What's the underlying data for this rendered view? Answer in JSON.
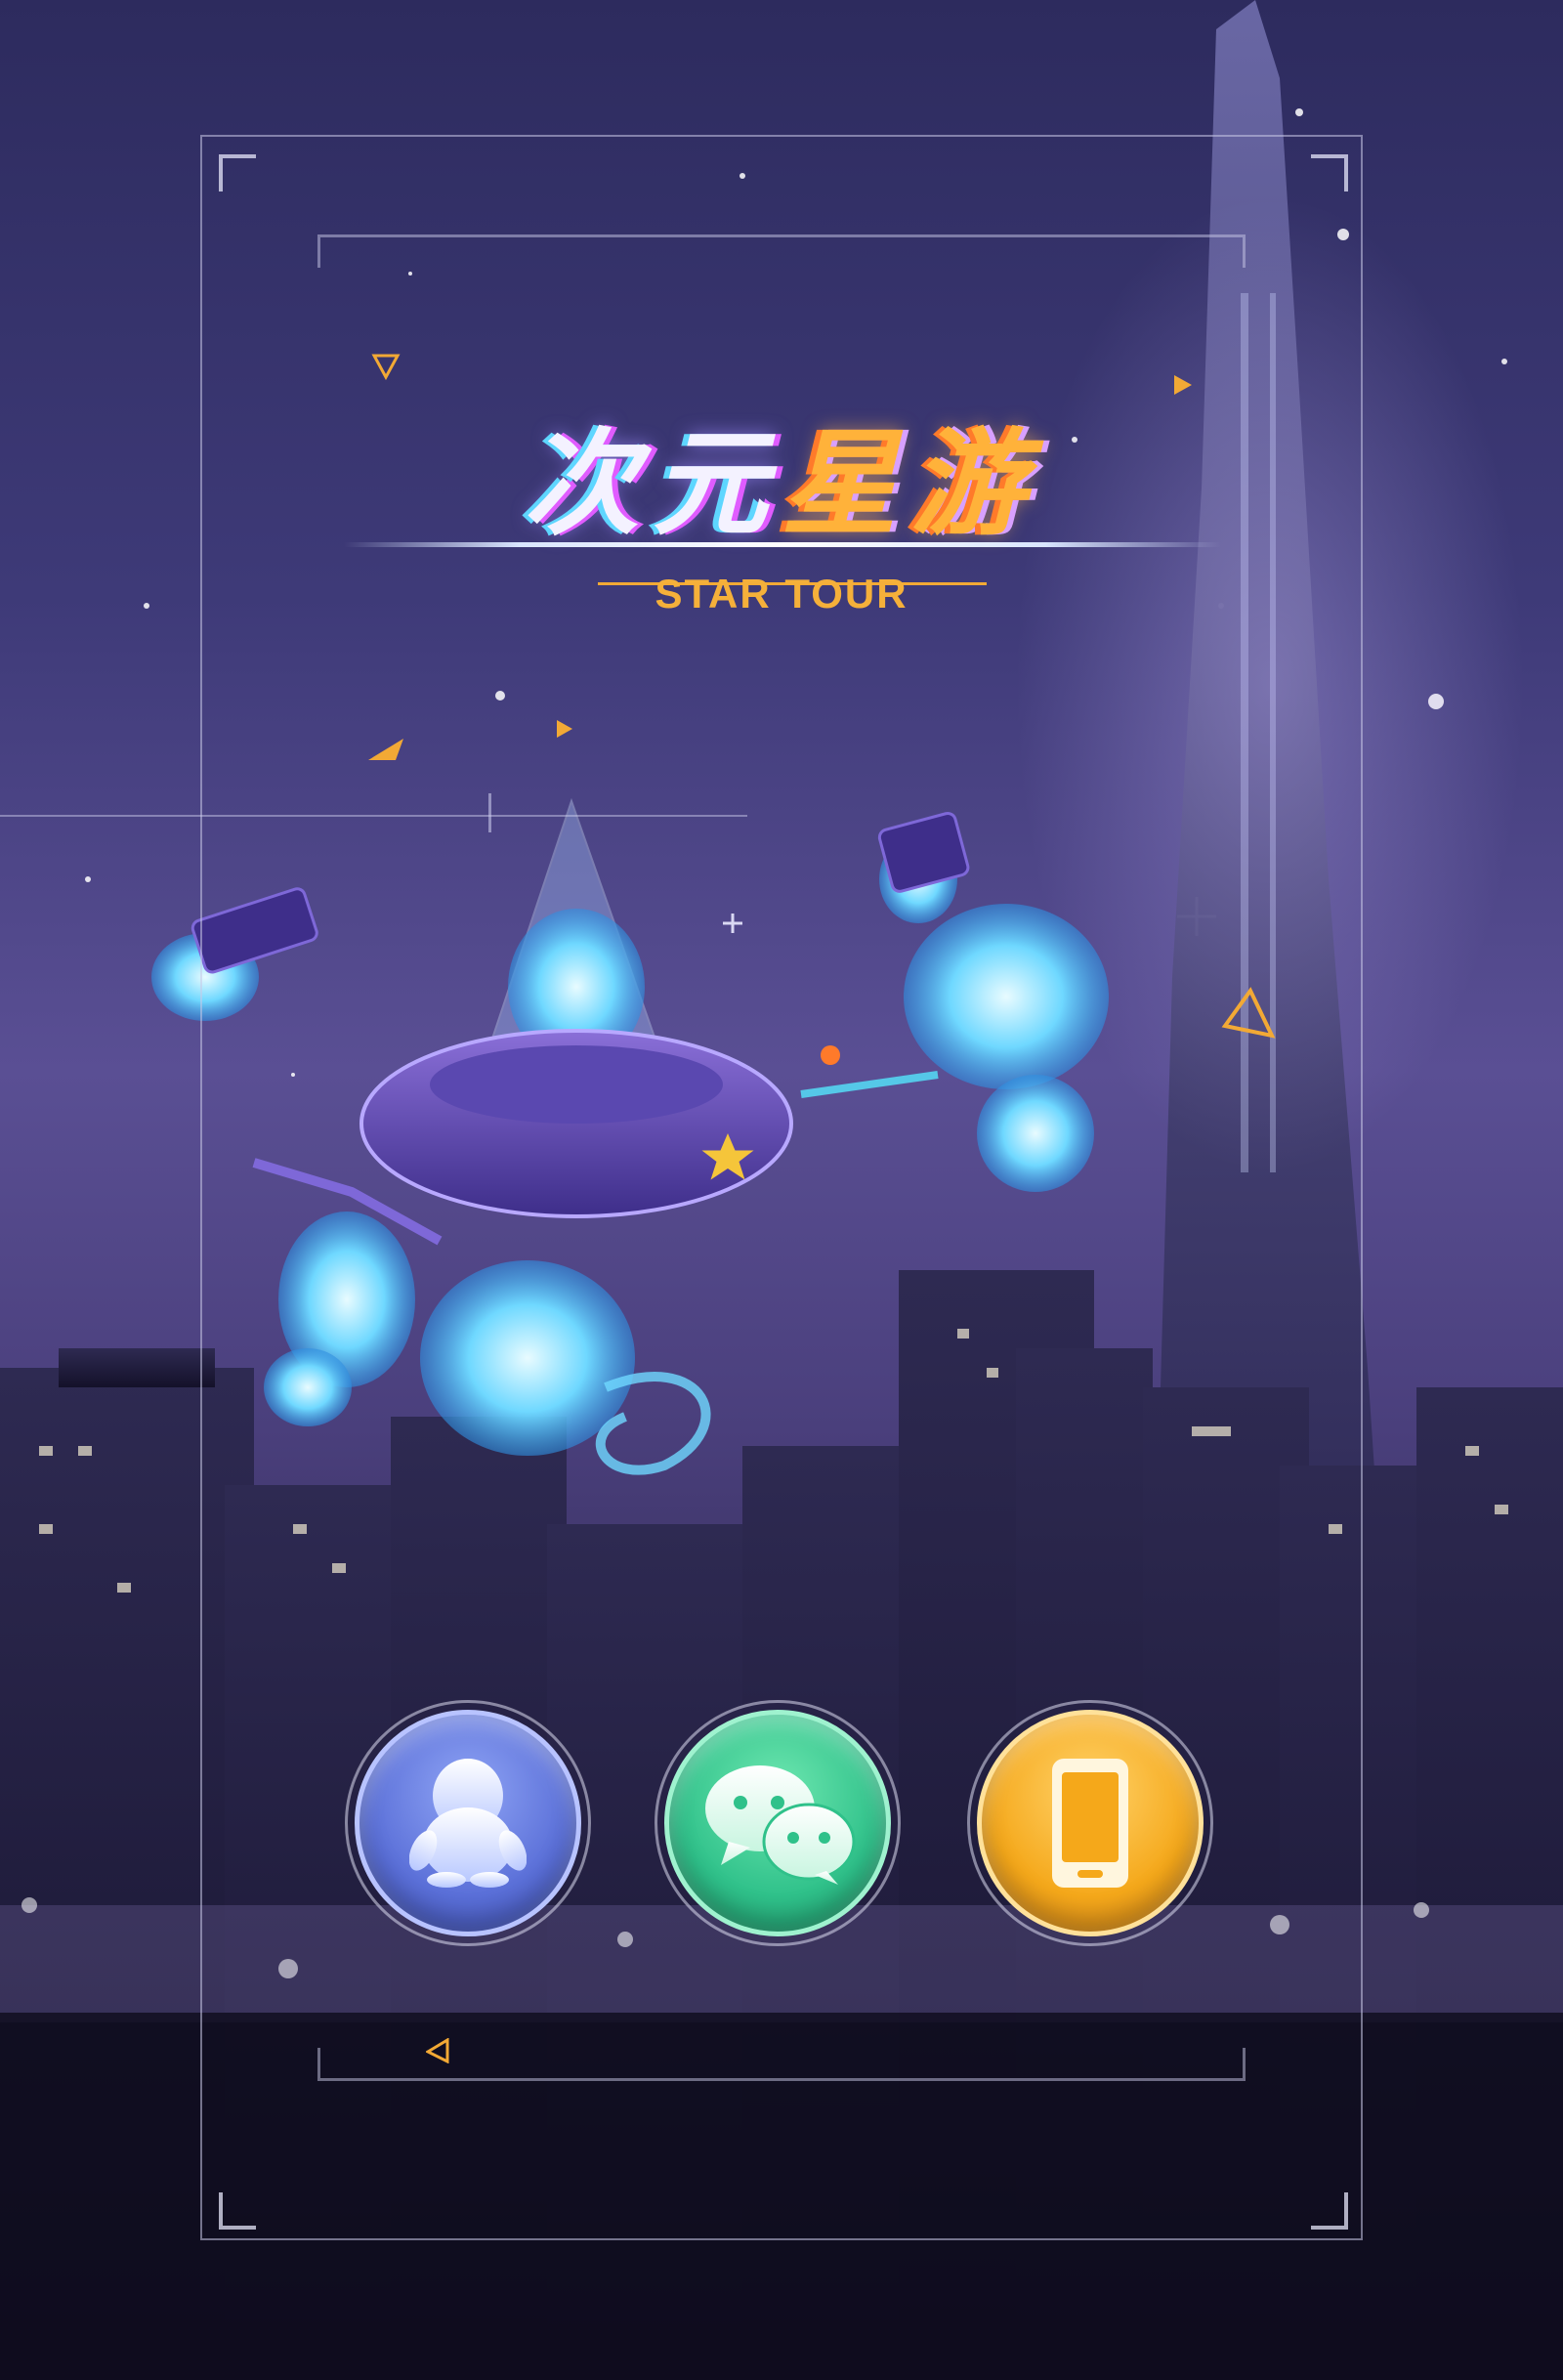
{
  "title": {
    "main_prefix": "次元",
    "main_highlight": "星游",
    "subtitle": "STAR TOUR"
  },
  "login_options": [
    {
      "id": "qq",
      "icon": "qq-penguin-icon",
      "color": "#5a6fd8"
    },
    {
      "id": "wechat",
      "icon": "wechat-icon",
      "color": "#2fc18a"
    },
    {
      "id": "phone",
      "icon": "phone-icon",
      "color": "#f5a81a"
    }
  ],
  "colors": {
    "accent_orange": "#f5b03a",
    "frame_line": "#c8c8e6",
    "sky_top": "#2d2b5e",
    "sky_mid": "#5a4f94"
  },
  "artwork": {
    "character": "robot-mech-character",
    "background": "night-city-skyline"
  }
}
